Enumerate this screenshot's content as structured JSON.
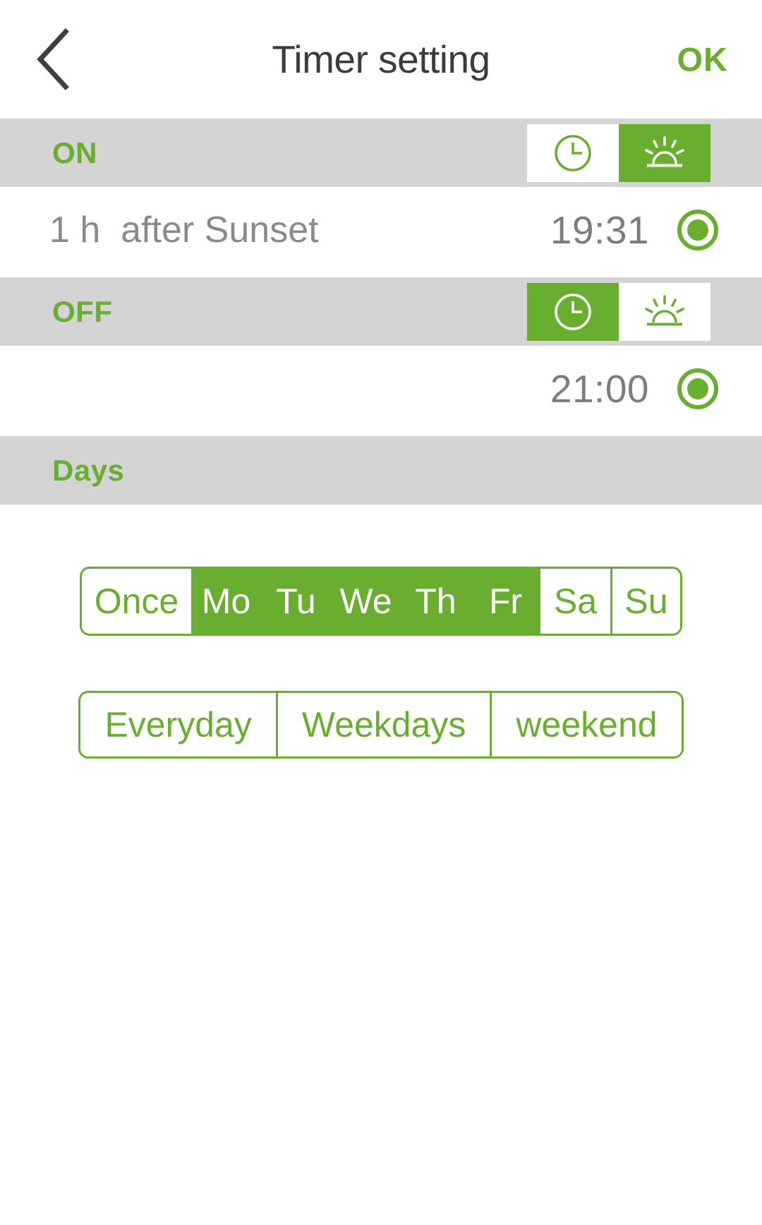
{
  "header": {
    "back_icon": "chevron-left-icon",
    "title": "Timer setting",
    "ok_label": "OK"
  },
  "colors": {
    "accent_green": "#69ae2e",
    "bar_grey": "#d4d4d4",
    "text_grey": "#8a8a8a",
    "title_dark": "#3b3b3b"
  },
  "on_section": {
    "label": "ON",
    "modes": [
      {
        "icon": "clock-icon",
        "selected": false
      },
      {
        "icon": "sunset-icon",
        "selected": true
      }
    ],
    "description": "1 h  after Sunset",
    "time": "19:31",
    "radio_selected": true
  },
  "off_section": {
    "label": "OFF",
    "modes": [
      {
        "icon": "clock-icon",
        "selected": true
      },
      {
        "icon": "sunset-icon",
        "selected": false
      }
    ],
    "description": "",
    "time": "21:00",
    "radio_selected": true
  },
  "days_section": {
    "label": "Days",
    "day_options": [
      {
        "label": "Once",
        "selected": false,
        "width": "once"
      },
      {
        "label": "Mo",
        "selected": true,
        "width": "day"
      },
      {
        "label": "Tu",
        "selected": true,
        "width": "day"
      },
      {
        "label": "We",
        "selected": true,
        "width": "day"
      },
      {
        "label": "Th",
        "selected": true,
        "width": "day"
      },
      {
        "label": "Fr",
        "selected": true,
        "width": "day"
      },
      {
        "label": "Sa",
        "selected": false,
        "width": "day"
      },
      {
        "label": "Su",
        "selected": false,
        "width": "day"
      }
    ],
    "presets": [
      {
        "label": "Everyday",
        "selected": false
      },
      {
        "label": "Weekdays",
        "selected": false
      },
      {
        "label": "weekend",
        "selected": false
      }
    ]
  }
}
